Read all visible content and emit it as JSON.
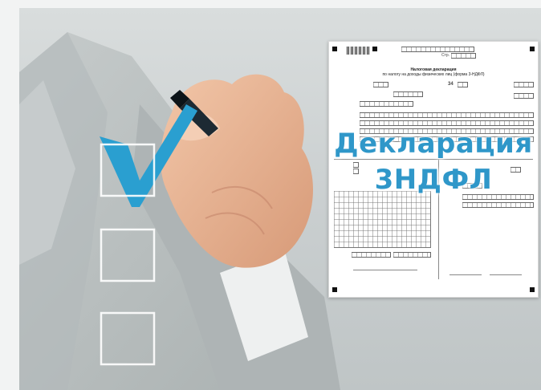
{
  "document": {
    "page_marker": "Стр.",
    "title_line1": "Налоговая декларация",
    "title_line2": "по налогу на доходы физических лиц (форма 3-НДФЛ)",
    "overlay_title_line1": "Декларация",
    "overlay_title_line2": "3НДФЛ",
    "period_code": "34"
  },
  "colors": {
    "overlay_text": "#2f97c9",
    "check_mark": "#2a9fd0",
    "suit": "#b9bfbf"
  },
  "icons": [
    "check-mark-icon",
    "empty-checkbox-icon",
    "marker-pen-icon",
    "barcode-icon"
  ]
}
